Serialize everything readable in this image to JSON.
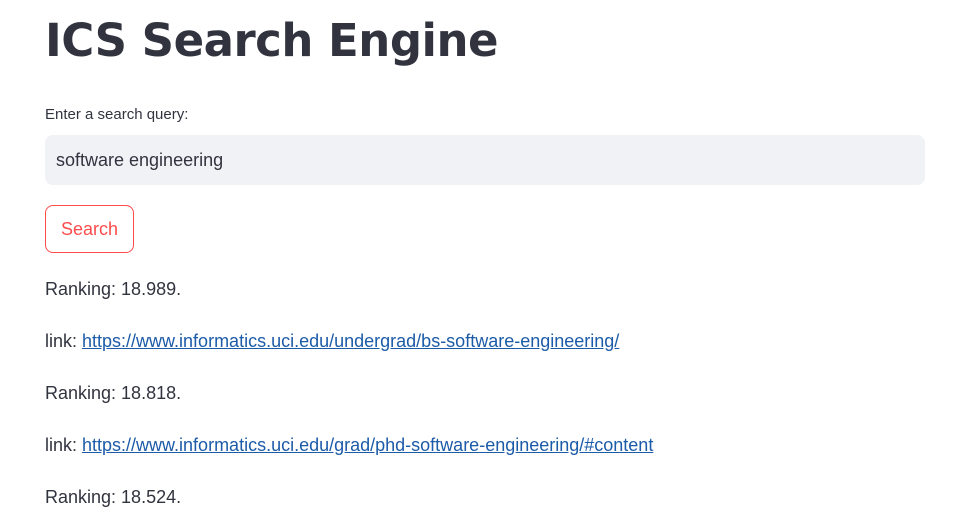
{
  "app": {
    "title": "ICS Search Engine"
  },
  "search": {
    "label": "Enter a search query:",
    "value": "software engineering",
    "button_label": "Search"
  },
  "results": [
    {
      "ranking_text": "Ranking: 18.989.",
      "link_prefix": "link: ",
      "url": "https://www.informatics.uci.edu/undergrad/bs-software-engineering/"
    },
    {
      "ranking_text": "Ranking: 18.818.",
      "link_prefix": "link: ",
      "url": "https://www.informatics.uci.edu/grad/phd-software-engineering/#content"
    },
    {
      "ranking_text": "Ranking: 18.524."
    }
  ],
  "colors": {
    "accent": "#ff4b4b",
    "text": "#31333f",
    "link": "#1c5ba8",
    "input_bg": "#f0f2f6"
  }
}
